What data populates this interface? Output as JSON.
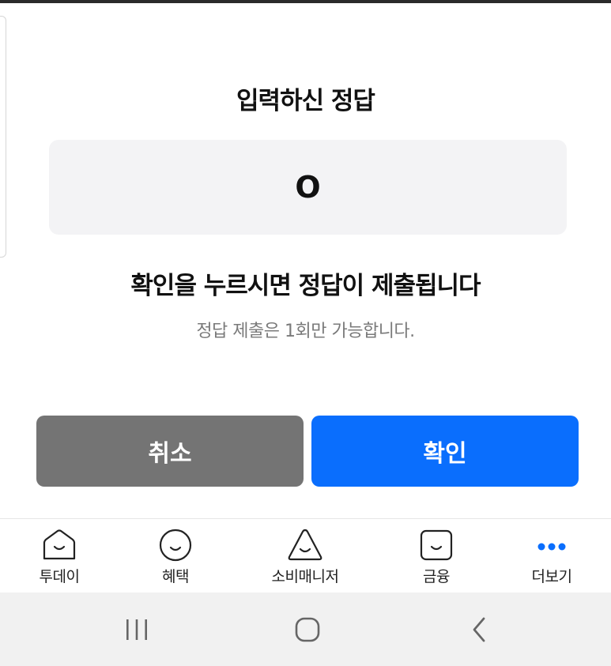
{
  "dialog": {
    "title": "입력하신 정답",
    "answer_value": "O",
    "headline": "확인을 누르시면 정답이 제출됩니다",
    "subtext": "정답 제출은 1회만 가능합니다.",
    "cancel_label": "취소",
    "confirm_label": "확인"
  },
  "colors": {
    "cancel_bg": "#747474",
    "confirm_bg": "#0a6efd",
    "more_dots": "#0a6efd"
  },
  "tabs": [
    {
      "label": "투데이",
      "icon": "home-face-icon"
    },
    {
      "label": "혜택",
      "icon": "circle-face-icon"
    },
    {
      "label": "소비매니저",
      "icon": "triangle-face-icon"
    },
    {
      "label": "금융",
      "icon": "square-face-icon"
    },
    {
      "label": "더보기",
      "icon": "more-dots-icon"
    }
  ],
  "system_nav": {
    "recents": "recents-icon",
    "home": "home-nav-icon",
    "back": "back-icon"
  }
}
